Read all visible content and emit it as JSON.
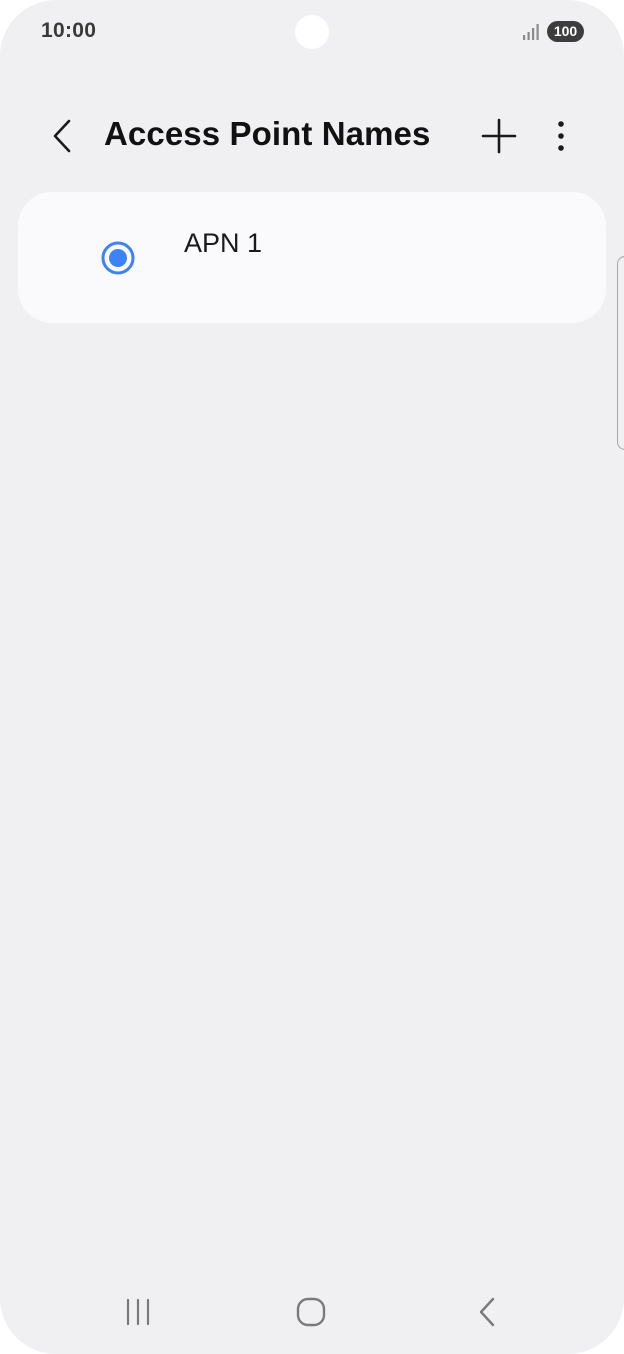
{
  "status_bar": {
    "time": "10:00",
    "battery": "100",
    "icons": [
      "camera-cutout",
      "signal-icon",
      "battery-icon"
    ]
  },
  "header": {
    "title": "Access Point Names",
    "icons": [
      "back-arrow-icon",
      "plus-icon",
      "more-vertical-icon"
    ]
  },
  "apn_list": [
    {
      "label": "APN 1",
      "selected": true
    }
  ],
  "nav_bar": {
    "icons": [
      "recents-icon",
      "home-icon",
      "back-icon"
    ]
  },
  "colors": {
    "background": "#f0f0f3",
    "card": "#fafafc",
    "accent": "#3e82f7",
    "text": "#111111"
  }
}
